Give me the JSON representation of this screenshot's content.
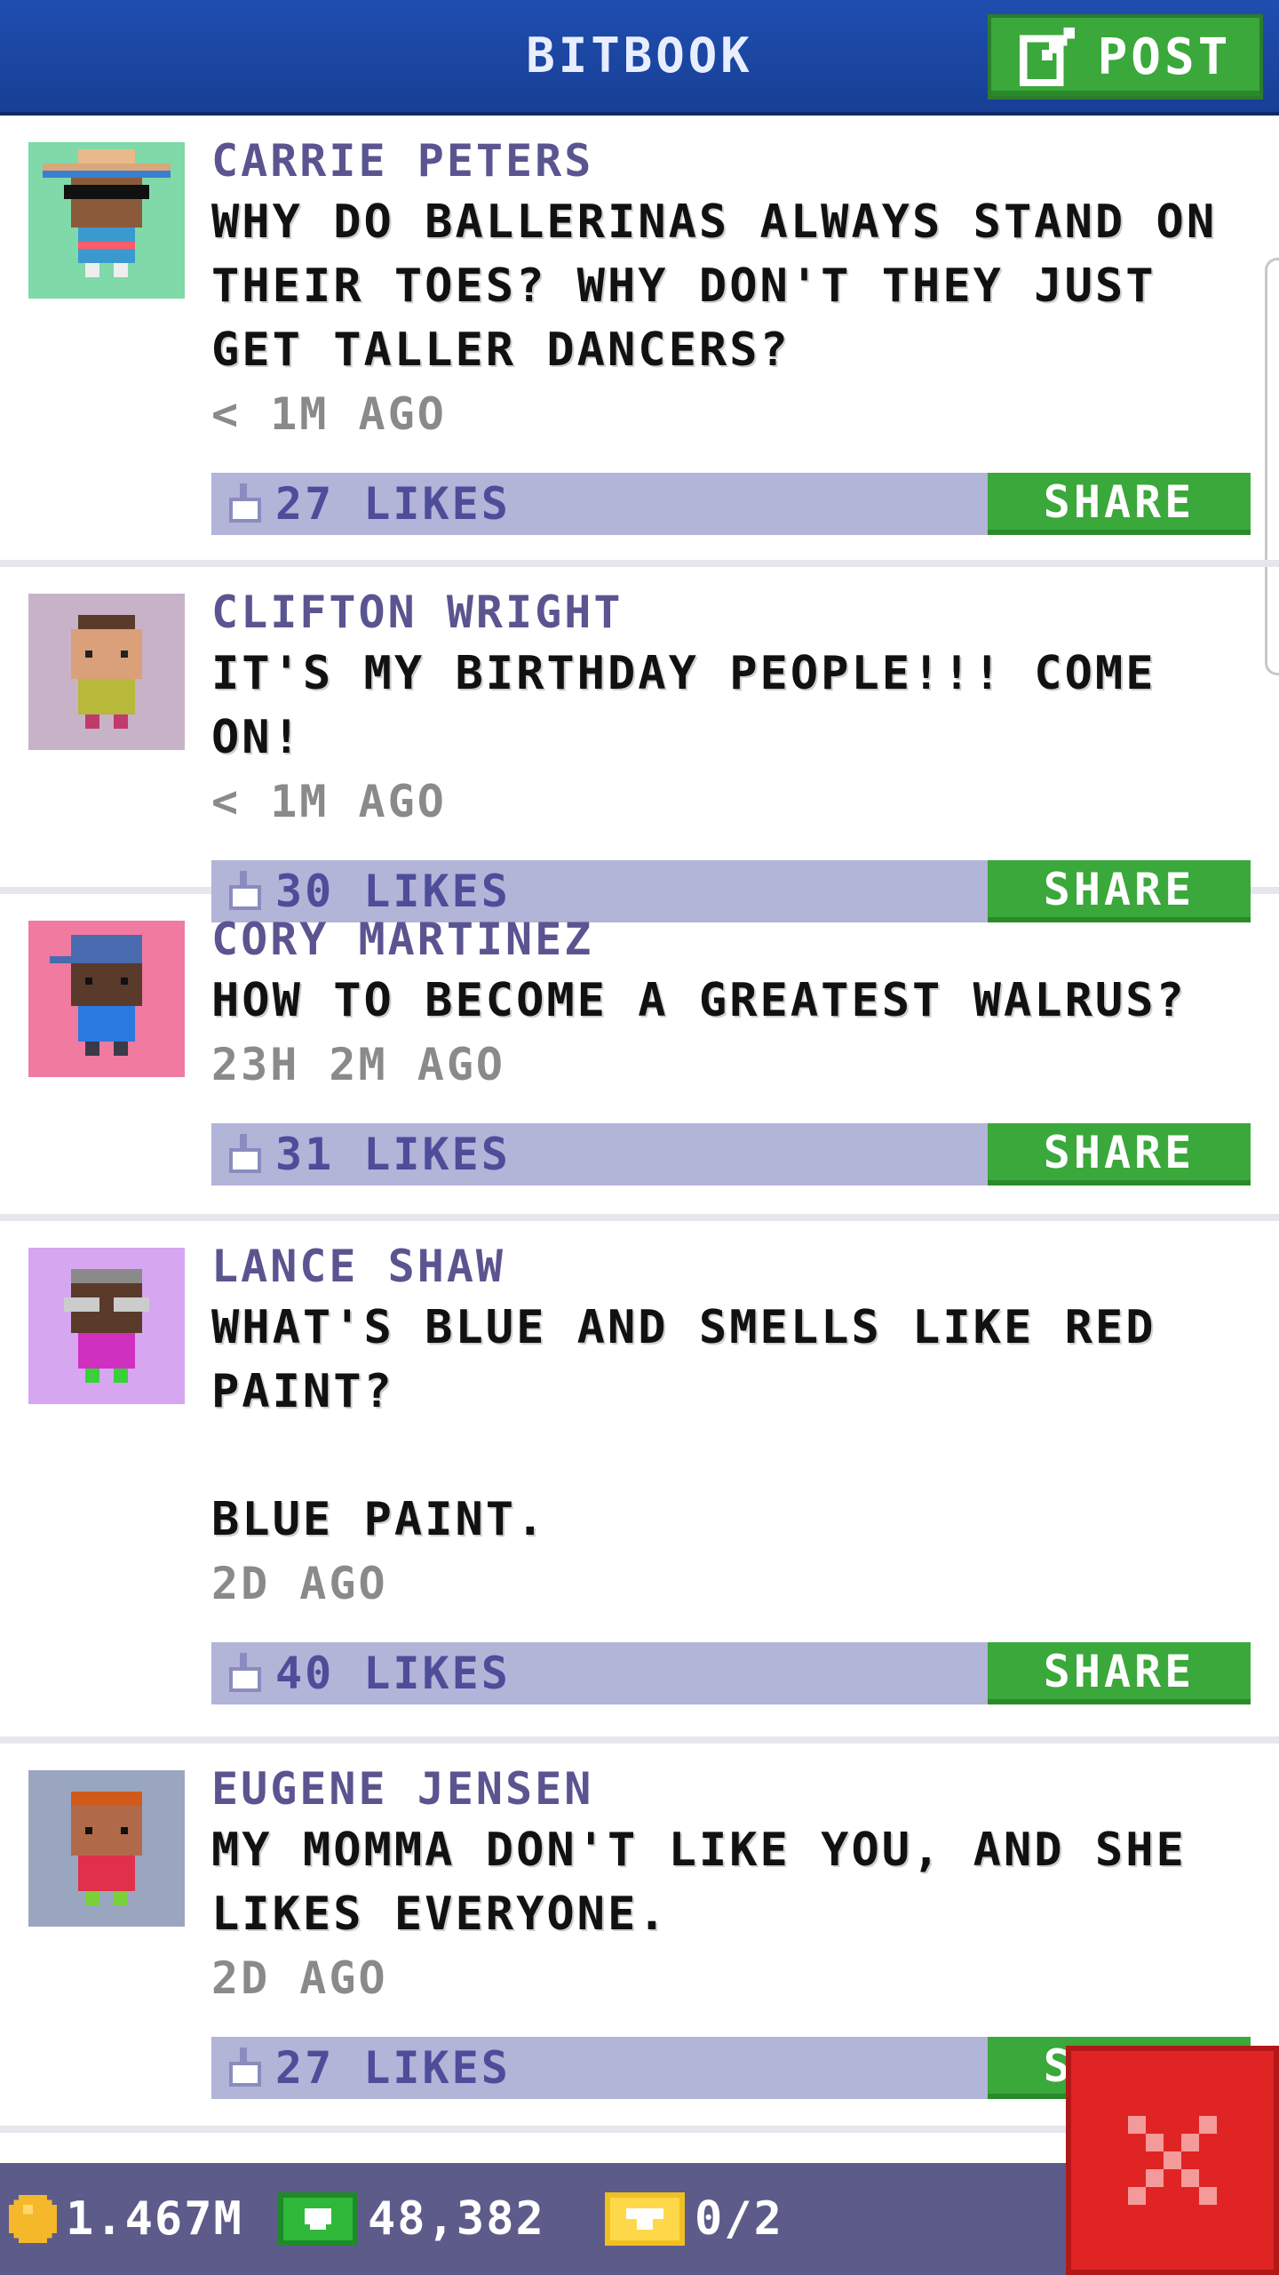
{
  "header": {
    "title": "BITBOOK",
    "post_label": "POST"
  },
  "posts": [
    {
      "author": "CARRIE PETERS",
      "text": "WHY DO BALLERINAS ALWAYS STAND ON THEIR TOES? WHY DON'T THEY JUST GET TALLER DANCERS?",
      "time": "< 1M AGO",
      "likes": "27 LIKES",
      "share": "SHARE"
    },
    {
      "author": "CLIFTON WRIGHT",
      "text": "IT'S MY BIRTHDAY PEOPLE!!! COME ON!",
      "time": "< 1M AGO",
      "likes": "30 LIKES",
      "share": "SHARE"
    },
    {
      "author": "CORY MARTINEZ",
      "text": "HOW TO BECOME A GREATEST WALRUS?",
      "time": "23H 2M AGO",
      "likes": "31 LIKES",
      "share": "SHARE"
    },
    {
      "author": "LANCE SHAW",
      "text": "WHAT'S BLUE AND SMELLS LIKE RED PAINT?\n\nBLUE PAINT.",
      "time": "2D AGO",
      "likes": "40 LIKES",
      "share": "SHARE"
    },
    {
      "author": "EUGENE JENSEN",
      "text": "MY MOMMA DON'T LIKE YOU, AND SHE LIKES EVERYONE.",
      "time": "2D AGO",
      "likes": "27 LIKES",
      "share": "SHARE"
    }
  ],
  "status": {
    "coins": "1.467M",
    "bux": "48,382",
    "tickets": "0/2"
  },
  "colors": {
    "header": "#1f4eb0",
    "like_bar": "#b2b4d8",
    "share": "#3aa83a",
    "close": "#e02424"
  },
  "icons": {
    "post": "edit-icon",
    "like": "thumbs-up-icon",
    "close": "close-icon",
    "coin": "coin-icon",
    "bux": "bux-icon",
    "ticket": "ticket-icon"
  }
}
